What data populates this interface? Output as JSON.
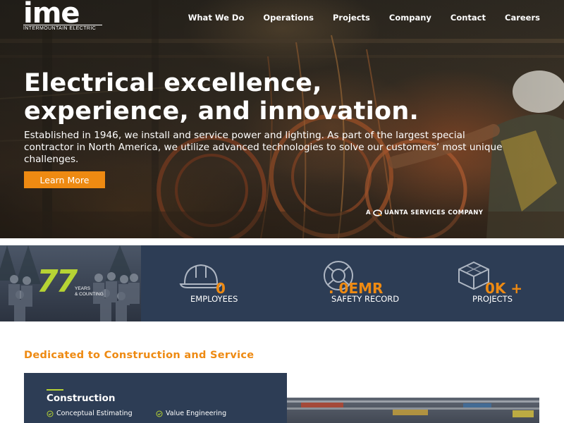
{
  "header": {
    "logo": {
      "word": "ime",
      "subtitle": "INTERMOUNTAIN ELECTRIC"
    },
    "nav": [
      {
        "label": "What We Do"
      },
      {
        "label": "Operations"
      },
      {
        "label": "Projects"
      },
      {
        "label": "Company"
      },
      {
        "label": "Contact"
      },
      {
        "label": "Careers"
      }
    ]
  },
  "hero": {
    "title": "Electrical excellence, experience, and innovation.",
    "text": "Established in 1946, we install and service power and lighting. As part of the largest special contractor in North America, we utilize advanced technologies to solve our customers’ most unique challenges.",
    "button_label": "Learn More",
    "quanta_prefix": "A",
    "quanta_rest": "UANTA SERVICES COMPANY"
  },
  "stats": {
    "years": {
      "value": "77",
      "sub_line1": "YEARS",
      "sub_line2": "& COUNTING"
    },
    "items": [
      {
        "icon": "hard-hat-icon",
        "value": "0",
        "label": "EMPLOYEES"
      },
      {
        "icon": "life-ring-icon",
        "value": ". 0EMR",
        "label": "SAFETY RECORD"
      },
      {
        "icon": "cube-icon",
        "value": "0K +",
        "label": "PROJECTS"
      }
    ]
  },
  "section": {
    "title": "Dedicated to Construction and Service",
    "card": {
      "title": "Construction",
      "items": [
        "Conceptual Estimating",
        "Value Engineering"
      ]
    }
  },
  "colors": {
    "accent_orange": "#ee8a12",
    "navy": "#2d3d55",
    "lime": "#b6d334"
  }
}
